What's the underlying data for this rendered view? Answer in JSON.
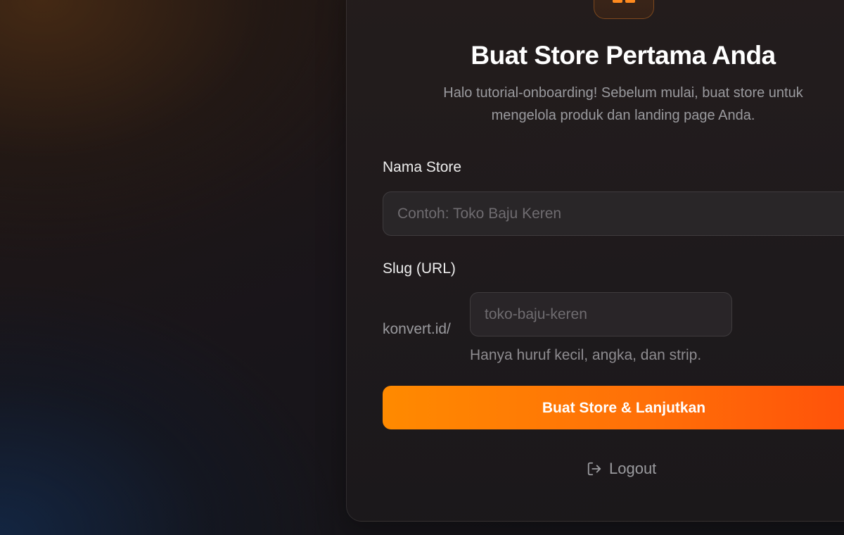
{
  "card": {
    "title": "Buat Store Pertama Anda",
    "subtitle_line1": "Halo tutorial-onboarding! Sebelum mulai, buat store untuk",
    "subtitle_line2": "mengelola produk dan landing page Anda."
  },
  "form": {
    "store_name": {
      "label": "Nama Store",
      "value": "",
      "placeholder": "Contoh: Toko Baju Keren"
    },
    "slug": {
      "label": "Slug (URL)",
      "prefix": "konvert.id/",
      "value": "",
      "placeholder": "toko-baju-keren",
      "hint": "Hanya huruf kecil, angka, dan strip."
    },
    "submit_label": "Buat Store & Lanjutkan"
  },
  "logout": {
    "label": "Logout",
    "icon": "logout-icon"
  },
  "colors": {
    "accent_start": "#ff8a00",
    "accent_end": "#ff4e0a"
  }
}
